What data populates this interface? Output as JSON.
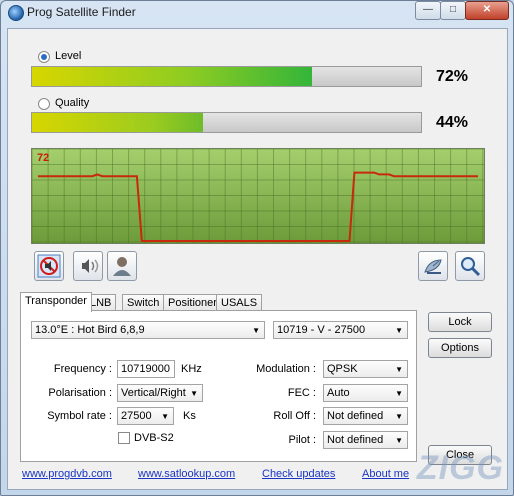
{
  "window": {
    "title": "Prog Satellite Finder"
  },
  "meters": {
    "level": {
      "label": "Level",
      "percent_text": "72%",
      "fraction": 0.72
    },
    "quality": {
      "label": "Quality",
      "percent_text": "44%",
      "fraction": 0.44
    }
  },
  "graph": {
    "value_label": "72",
    "samples": [
      72,
      72,
      72,
      72,
      72,
      72,
      72,
      72,
      72,
      72,
      72,
      72,
      74,
      72,
      72,
      72,
      72,
      72,
      72,
      72,
      72,
      0,
      0,
      0,
      0,
      0,
      0,
      0,
      0,
      0,
      0,
      0,
      0,
      0,
      0,
      0,
      0,
      0,
      0,
      0,
      0,
      0,
      0,
      0,
      0,
      0,
      0,
      0,
      0,
      0,
      0,
      0,
      0,
      0,
      0,
      0,
      0,
      0,
      0,
      0,
      0,
      0,
      0,
      0,
      76,
      76,
      76,
      76,
      76,
      74,
      74,
      74,
      72,
      72,
      72,
      72,
      72,
      72,
      72,
      72,
      72,
      72,
      72,
      72,
      72,
      72,
      72,
      72,
      72,
      72
    ]
  },
  "tabs": [
    "Transponder",
    "LNB",
    "Switch",
    "Positioner",
    "USALS"
  ],
  "transponder": {
    "satellite": "13.0°E : Hot Bird 6,8,9",
    "transponder": "10719 - V - 27500",
    "frequency_label": "Frequency :",
    "frequency_value": "10719000",
    "frequency_unit": "KHz",
    "polarisation_label": "Polarisation :",
    "polarisation_value": "Vertical/Right",
    "symbol_rate_label": "Symbol rate :",
    "symbol_rate_value": "27500",
    "symbol_rate_unit": "Ks",
    "dvbs2_label": "DVB-S2",
    "modulation_label": "Modulation :",
    "modulation_value": "QPSK",
    "fec_label": "FEC :",
    "fec_value": "Auto",
    "rolloff_label": "Roll Off :",
    "rolloff_value": "Not defined",
    "pilot_label": "Pilot :",
    "pilot_value": "Not defined"
  },
  "buttons": {
    "lock": "Lock",
    "options": "Options",
    "close": "Close"
  },
  "links": [
    "www.progdvb.com",
    "www.satlookup.com",
    "Check updates",
    "About me"
  ],
  "watermark": "ZIGG",
  "colors": {
    "graph_line": "#c8290c",
    "graph_bg": "#8dbb52",
    "bar_green": "#34b53a"
  }
}
